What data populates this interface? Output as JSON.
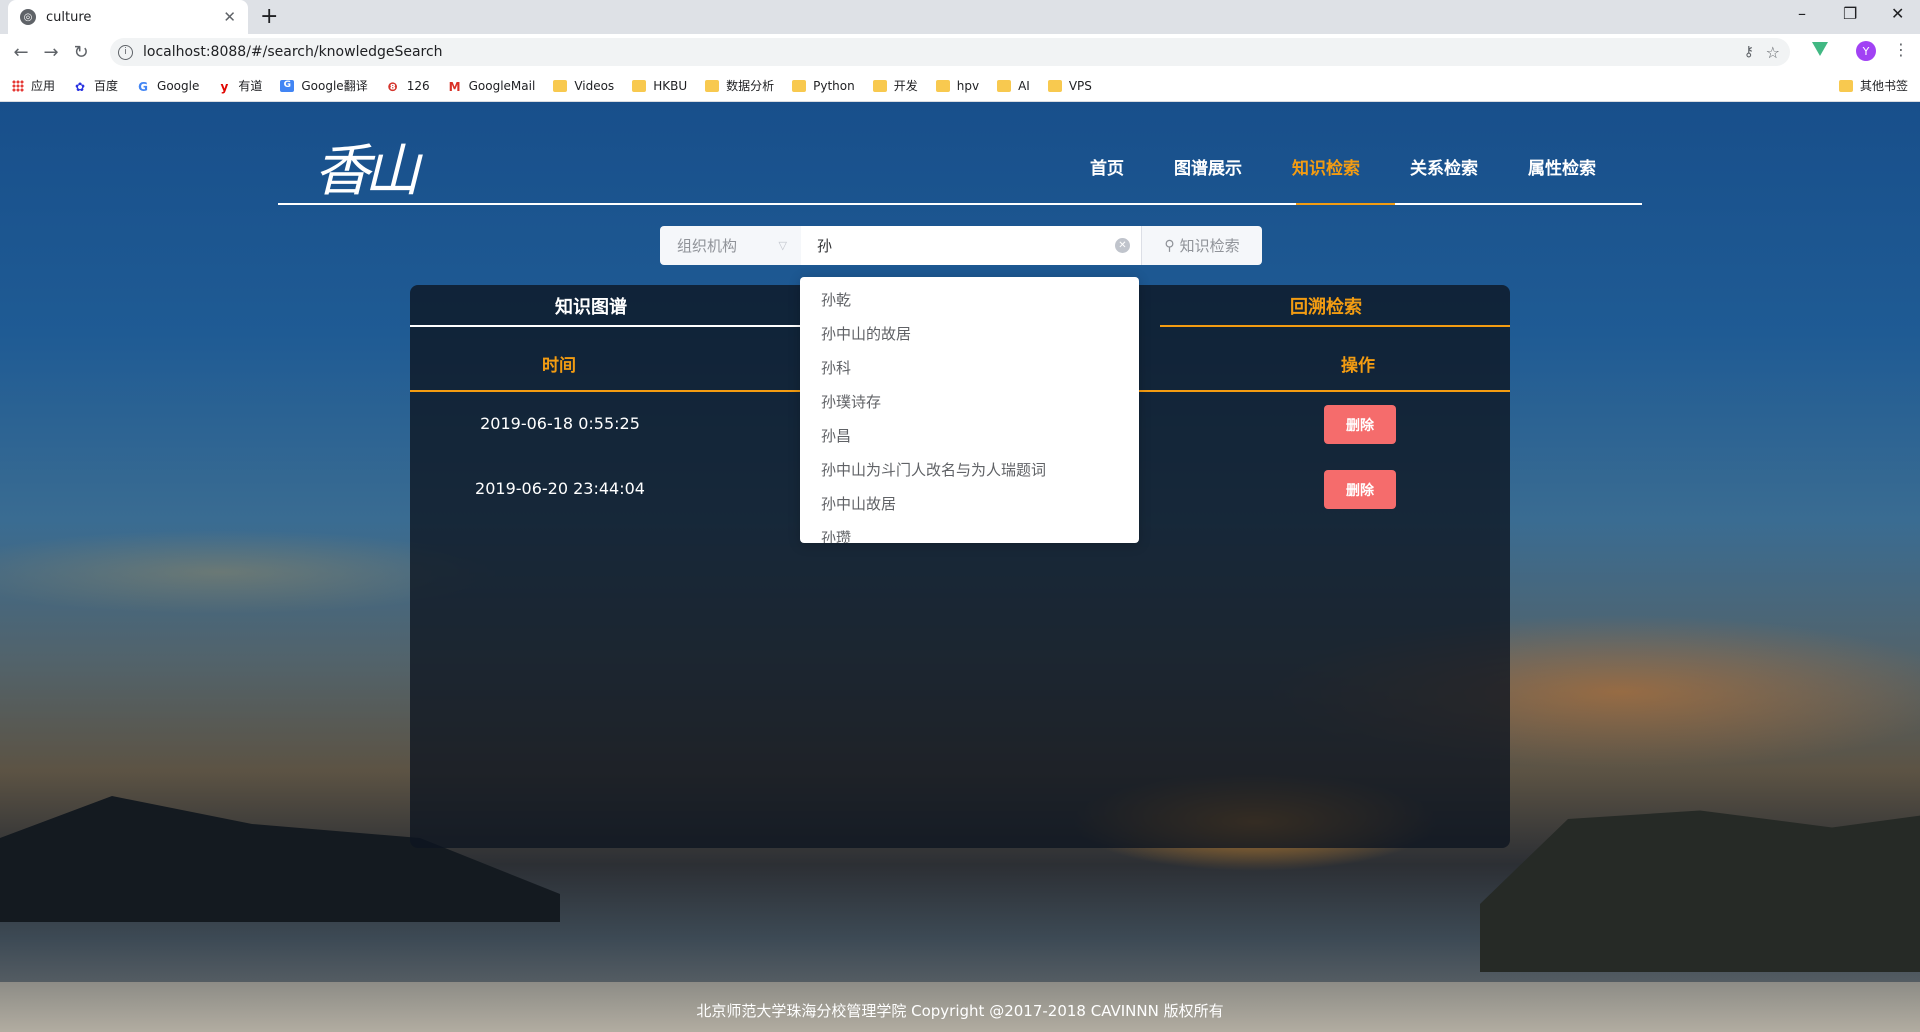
{
  "browser": {
    "tab_title": "culture",
    "url": "localhost:8088/#/search/knowledgeSearch",
    "avatar_letter": "Y",
    "bookmarks": [
      "应用",
      "百度",
      "Google",
      "有道",
      "Google翻译",
      "126",
      "GoogleMail",
      "Videos",
      "HKBU",
      "数据分析",
      "Python",
      "开发",
      "hpv",
      "AI",
      "VPS"
    ],
    "other_bookmarks": "其他书签"
  },
  "header": {
    "nav": [
      "首页",
      "图谱展示",
      "知识检索",
      "关系检索",
      "属性检索"
    ],
    "active_nav": "知识检索"
  },
  "search": {
    "category": "组织机构",
    "query": "孙",
    "button_label": "知识检索"
  },
  "suggestions": [
    "孙乾",
    "孙中山的故居",
    "孙科",
    "孙璞诗存",
    "孙昌",
    "孙中山为斗门人改名与为人瑞题词",
    "孙中山故居",
    "孙瓒"
  ],
  "panel": {
    "tab_graph": "知识图谱",
    "tab_history": "回溯检索",
    "col_time": "时间",
    "col_action": "操作",
    "rows": [
      {
        "time": "2019-06-18 0:55:25",
        "action": "删除"
      },
      {
        "time": "2019-06-20 23:44:04",
        "action": "删除"
      }
    ]
  },
  "footer": "北京师范大学珠海分校管理学院 Copyright @2017-2018 CAVINNN 版权所有",
  "colors": {
    "accent": "#f39c12",
    "danger": "#f56c6c"
  }
}
